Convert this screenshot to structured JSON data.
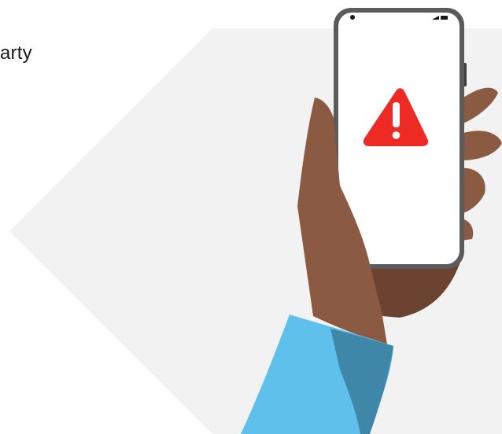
{
  "heading_fragment": "arty",
  "illustration": {
    "alert_symbol": "warning-triangle-icon",
    "colors": {
      "hexagon_background": "#f2f2f3",
      "skin": "#8a5a42",
      "skin_shadow": "#6b4330",
      "sleeve": "#5fc0ec",
      "sleeve_shadow": "#3f87a8",
      "phone_frame": "#5b5b5b",
      "phone_screen": "#ffffff",
      "warning_red": "#ee2a24"
    }
  }
}
